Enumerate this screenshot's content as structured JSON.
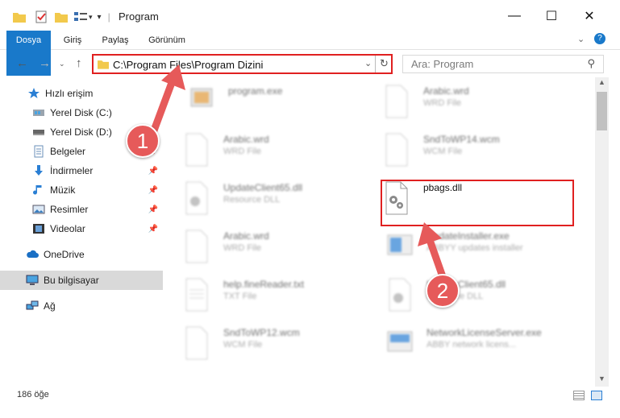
{
  "window": {
    "title": "Program",
    "minimize": "—",
    "maximize": "☐",
    "close": "✕"
  },
  "ribbon": {
    "tabs": [
      "Dosya",
      "Giriş",
      "Paylaş",
      "Görünüm"
    ]
  },
  "address": {
    "path": "C:\\Program Files\\Program Dizini"
  },
  "search": {
    "placeholder": "Ara: Program"
  },
  "sidebar": {
    "items": [
      {
        "label": "Hızlı erişim",
        "icon": "star-icon"
      },
      {
        "label": "Yerel Disk (C:)",
        "icon": "drive-icon",
        "pinned": true
      },
      {
        "label": "Yerel Disk (D:)",
        "icon": "drive-icon",
        "pinned": true
      },
      {
        "label": "Belgeler",
        "icon": "documents-icon",
        "pinned": true
      },
      {
        "label": "İndirmeler",
        "icon": "download-icon",
        "pinned": true
      },
      {
        "label": "Müzik",
        "icon": "music-icon",
        "pinned": true
      },
      {
        "label": "Resimler",
        "icon": "pictures-icon",
        "pinned": true
      },
      {
        "label": "Videolar",
        "icon": "videos-icon",
        "pinned": true
      },
      {
        "label": "OneDrive",
        "icon": "cloud-icon"
      },
      {
        "label": "Bu bilgisayar",
        "icon": "computer-icon",
        "selected": true
      },
      {
        "label": "Ağ",
        "icon": "network-icon"
      }
    ]
  },
  "files": [
    {
      "name": "program.exe",
      "type": ""
    },
    {
      "name": "Arabic.wrd",
      "type": "WRD File"
    },
    {
      "name": "Arabic.wrd",
      "type": "WRD File"
    },
    {
      "name": "SndToWP14.wcm",
      "type": "WCM File"
    },
    {
      "name": "UpdateClient65.dll",
      "type": "Resource DLL"
    },
    {
      "name": "pbags.dll",
      "type": ""
    },
    {
      "name": "Arabic.wrd",
      "type": "WRD File"
    },
    {
      "name": "UpdateInstaller.exe",
      "type": "ABBYY updates installer"
    },
    {
      "name": "help.fineReader.txt",
      "type": "TXT File"
    },
    {
      "name": "UpdateClient65.dll",
      "type": "Resource DLL"
    },
    {
      "name": "SndToWP12.wcm",
      "type": "WCM File"
    },
    {
      "name": "NetworkLicenseServer.exe",
      "type": "ABBY network licens..."
    }
  ],
  "status": {
    "count": "186 öğe"
  },
  "annotations": {
    "step1": "1",
    "step2": "2"
  },
  "colors": {
    "accent": "#1979ca",
    "highlight": "#e02020",
    "arrow": "#e65a5a"
  }
}
